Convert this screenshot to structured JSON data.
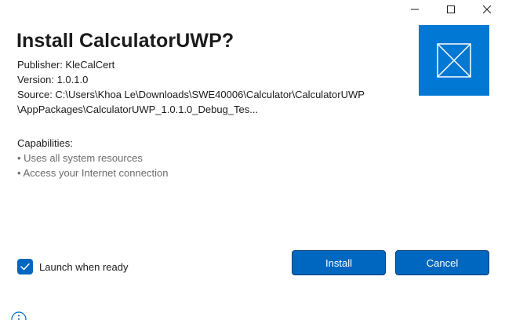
{
  "window": {
    "controls": {
      "minimize_icon": "minimize-icon",
      "maximize_icon": "maximize-icon",
      "close_icon": "close-icon"
    }
  },
  "installer": {
    "title": "Install CalculatorUWP?",
    "publisher": "Publisher: KleCalCert",
    "version": "Version: 1.0.1.0",
    "source_line1": "Source: C:\\Users\\Khoa Le\\Downloads\\SWE40006\\Calculator\\CalculatorUWP",
    "source_line2": "\\AppPackages\\CalculatorUWP_1.0.1.0_Debug_Tes...",
    "app_icon": "placeholder-app-icon",
    "accent_color": "#0078d4"
  },
  "capabilities": {
    "title": "Capabilities:",
    "items": [
      "• Uses all system resources",
      "• Access your Internet connection"
    ]
  },
  "footer": {
    "launch_label": "Launch when ready",
    "launch_checked": true,
    "install_label": "Install",
    "cancel_label": "Cancel",
    "button_color": "#0067c0",
    "info_icon": "info-icon"
  }
}
